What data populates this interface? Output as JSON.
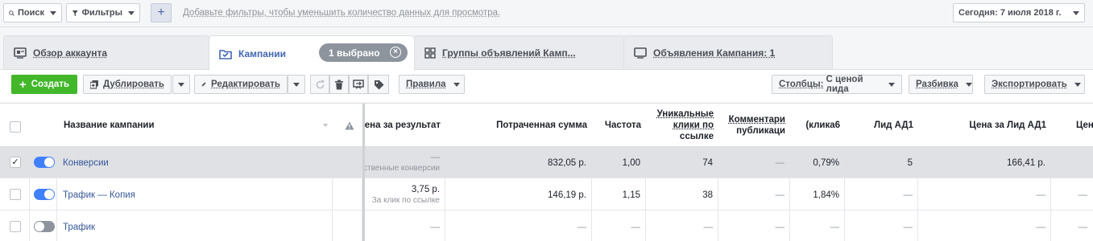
{
  "topbar": {
    "search_label": "Поиск",
    "filters_label": "Фильтры",
    "add_label": "+",
    "hint": "Добавьте фильтры, чтобы уменьшить количество данных для просмотра.",
    "date_label": "Сегодня: 7 июля 2018 г."
  },
  "tabs": [
    {
      "label": "Обзор аккаунта",
      "icon": "account-overview-icon"
    },
    {
      "label": "Кампании",
      "icon": "folder-icon",
      "active": true
    },
    {
      "label": "Группы объявлений Камп...",
      "icon": "grid-icon"
    },
    {
      "label": "Объявления Кампания: 1",
      "icon": "ad-icon"
    }
  ],
  "selection": {
    "label": "1 выбрано",
    "clear": "⊗"
  },
  "toolbar": {
    "create_label": "Создать",
    "duplicate_label": "Дублировать",
    "edit_label": "Редактировать",
    "rules_label": "Правила",
    "columns_prefix": "Столбцы:",
    "columns_value": "С ценой лида",
    "breakdown_label": "Разбивка",
    "export_label": "Экспортировать"
  },
  "table": {
    "headers": {
      "name": "Название кампании",
      "result_cost": "Цена за результат",
      "spent": "Потраченная сумма",
      "frequency": "Частота",
      "unique_clicks": [
        "Уникальные",
        "клики по",
        "ссылке"
      ],
      "comments": [
        "Комментари",
        "публикаци"
      ],
      "ctr": "(клика6",
      "lead": "Лид АД1",
      "lead_cost": "Цена за Лид АД1",
      "more": "Цен"
    },
    "rows": [
      {
        "selected": true,
        "active": true,
        "name": "Конверсии",
        "result_cost": "—",
        "result_sub": "ственные конверсии",
        "spent": "832,05 р.",
        "frequency": "1,00",
        "unique_clicks": "74",
        "comments": "—",
        "ctr": "0,79%",
        "lead": "5",
        "lead_cost": "166,41 р.",
        "more": ""
      },
      {
        "selected": false,
        "active": true,
        "name": "Трафик — Копия",
        "result_cost": "3,75 р.",
        "result_sub": "За клик по ссылке",
        "spent": "146,19 р.",
        "frequency": "1,15",
        "unique_clicks": "38",
        "comments": "—",
        "ctr": "1,84%",
        "lead": "—",
        "lead_cost": "—",
        "more": "—"
      },
      {
        "selected": false,
        "active": false,
        "name": "Трафик",
        "result_cost": "—",
        "result_sub": "",
        "spent": "—",
        "frequency": "—",
        "unique_clicks": "—",
        "comments": "—",
        "ctr": "—",
        "lead": "—",
        "lead_cost": "—",
        "more": "—"
      }
    ],
    "check_mark": "✓"
  },
  "colors": {
    "accent": "#4267b2",
    "create": "#42b72a",
    "toggle_on": "#4080ff",
    "selected_row": "#dfe1e5"
  }
}
